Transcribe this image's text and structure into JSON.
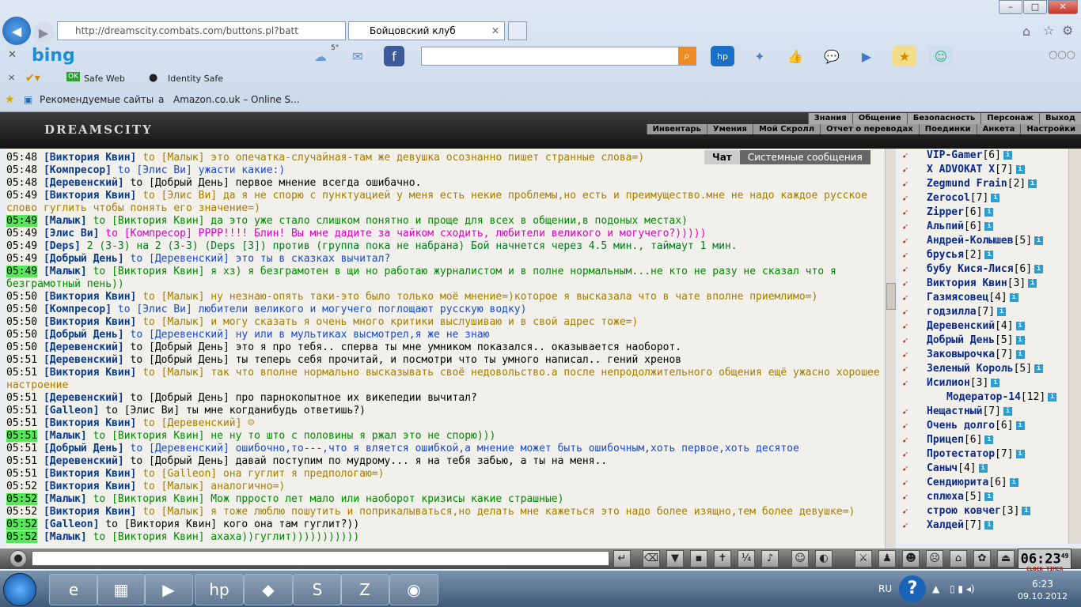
{
  "browser": {
    "address": "http://dreamscity.combats.com/buttons.pl?batt",
    "tab_title": "Бойцовский клуб",
    "bing_logo": "bing",
    "weather_temp": "5°",
    "safe_web": "Safe Web",
    "identity_safe": "Identity Safe",
    "fav_recommended": "Рекомендуемые сайты",
    "fav_amazon": "Amazon.co.uk – Online S..."
  },
  "game": {
    "logo": "DREAMSCITY",
    "menu_top": [
      "Знания",
      "Общение",
      "Безопасность",
      "Персонаж",
      "Выход"
    ],
    "menu_bottom": [
      "Инвентарь",
      "Умения",
      "Мой Скролл",
      "Отчет о переводах",
      "Поединки",
      "Анкета",
      "Настройки"
    ],
    "tab_chat": "Чат",
    "tab_system": "Системные сообщения",
    "clock_time": "06:23",
    "clock_sec": "49",
    "clock_label": "CLOCK",
    "timer_label": "TIMER"
  },
  "chat": [
    {
      "t": "05:48",
      "h": false,
      "n": "[Виктория Квин]",
      "c": "#a67c00",
      "m": "to [Малык] это опечатка-случайная-там же девушка осознанно пишет странные слова=)"
    },
    {
      "t": "05:48",
      "h": false,
      "n": "[Компресор]",
      "c": "#1a4ad0",
      "m": "to [Элис Ви] ужасти какие:)"
    },
    {
      "t": "05:48",
      "h": false,
      "n": "[Деревенский]",
      "c": "#000000",
      "m": "to [Добрый День] первое мнение всегда ошибачно."
    },
    {
      "t": "05:49",
      "h": false,
      "n": "[Виктория Квин]",
      "c": "#a67c00",
      "m": "to [Элис Ви] да я не спорю с пунктуацией у меня есть некие проблемы,но есть и преимущество.мне не надо каждое русское слово гуглить чтобы понять его значение=)"
    },
    {
      "t": "05:49",
      "h": true,
      "n": "[Малык]",
      "c": "#008a00",
      "m": "to [Виктория Квин] да это уже стало слишком понятно и проще для всех в общении,в подоных местах)"
    },
    {
      "t": "05:49",
      "h": false,
      "n": "[Элис Ви]",
      "c": "#e000c8",
      "m": "to [Компресор] РРРР!!!! Блин! Вы мне дадите за чайком сходить, любители великого и могучего?)))))"
    },
    {
      "t": "05:49",
      "h": false,
      "n": "[Deps]",
      "c": "#007a20",
      "m": "2 (3-3) на 2 (3-3) (Deps [3]) против (группа пока не набрана) Бой начнется через 4.5 мин., таймаут 1 мин."
    },
    {
      "t": "05:49",
      "h": false,
      "n": "[Добрый День]",
      "c": "#1a4ad0",
      "m": "to [Деревенский] это ты в сказках вычитал?"
    },
    {
      "t": "05:49",
      "h": true,
      "n": "[Малык]",
      "c": "#008a00",
      "m": "to [Виктория Квин] я хз) я безграмотен в щи но работаю журналистом и в полне нормальным...не кто не разу не сказал что я безграмотный пень))"
    },
    {
      "t": "05:50",
      "h": false,
      "n": "[Виктория Квин]",
      "c": "#a67c00",
      "m": "to [Малык] ну незнаю-опять таки-это было только моё мнение=)которое я высказала что в чате вполне приемлимо=)"
    },
    {
      "t": "05:50",
      "h": false,
      "n": "[Компресор]",
      "c": "#1a4ad0",
      "m": "to [Элис Ви] любители великого и могучего поглощают русскую водку)"
    },
    {
      "t": "05:50",
      "h": false,
      "n": "[Виктория Квин]",
      "c": "#a67c00",
      "m": "to [Малык] и могу сказать я очень много критики выслушиваю и в свой адрес тоже=)"
    },
    {
      "t": "05:50",
      "h": false,
      "n": "[Добрый День]",
      "c": "#1a4ad0",
      "m": "to [Деревенский] ну или в мультиках высмотрел,я же не знаю"
    },
    {
      "t": "05:50",
      "h": false,
      "n": "[Деревенский]",
      "c": "#000000",
      "m": "to [Добрый День] это я про тебя.. сперва ты мне умником показался.. оказывается наоборот."
    },
    {
      "t": "05:51",
      "h": false,
      "n": "[Деревенский]",
      "c": "#000000",
      "m": "to [Добрый День] ты теперь себя прочитай, и посмотри что ты умного написал.. гений хренов"
    },
    {
      "t": "05:51",
      "h": false,
      "n": "[Виктория Квин]",
      "c": "#a67c00",
      "m": "to [Малык] так что вполне нормально высказывать своё недовольство.а после непродолжительного общения ещё ужасно хорошее настроение"
    },
    {
      "t": "05:51",
      "h": false,
      "n": "[Деревенский]",
      "c": "#000000",
      "m": "to [Добрый День] про парнокопытное их викепедии вычитал?"
    },
    {
      "t": "05:51",
      "h": false,
      "n": "[Galleon]",
      "c": "#000000",
      "m": "to [Элис Ви] ты мне когданибудь ответишь?)"
    },
    {
      "t": "05:51",
      "h": false,
      "n": "[Виктория Квин]",
      "c": "#a67c00",
      "m": "to [Деревенский] ☺"
    },
    {
      "t": "05:51",
      "h": true,
      "n": "[Малык]",
      "c": "#008a00",
      "m": "to [Виктория Квин] не ну то што с половины я ржал это не спорю)))"
    },
    {
      "t": "05:51",
      "h": false,
      "n": "[Добрый День]",
      "c": "#1a4ad0",
      "m": "to [Деревенский] ошибочно,то---,что я вляется ошибкой,а мнение может быть ошибочным,хоть первое,хоть десятое"
    },
    {
      "t": "05:51",
      "h": false,
      "n": "[Деревенский]",
      "c": "#000000",
      "m": "to [Добрый День] давай поступим по мудрому... я на тебя забью, а ты на меня.."
    },
    {
      "t": "05:51",
      "h": false,
      "n": "[Виктория Квин]",
      "c": "#a67c00",
      "m": "to [Galleon] она гуглит я предпологаю=)"
    },
    {
      "t": "05:52",
      "h": false,
      "n": "[Виктория Квин]",
      "c": "#a67c00",
      "m": "to [Малык] аналогично=)"
    },
    {
      "t": "05:52",
      "h": true,
      "n": "[Малык]",
      "c": "#008a00",
      "m": "to [Виктория Квин] Мож прросто лет мало или наоборот кризисы какие страшные)"
    },
    {
      "t": "05:52",
      "h": false,
      "n": "[Виктория Квин]",
      "c": "#a67c00",
      "m": "to [Малык] я тоже люблю пошутить и поприкалываться,но делать мне кажеться это надо более изящно,тем более девушке=)"
    },
    {
      "t": "05:52",
      "h": true,
      "n": "[Galleon]",
      "c": "#000000",
      "m": "to [Виктория Квин] кого она там гуглит?))"
    },
    {
      "t": "05:52",
      "h": true,
      "n": "[Малык]",
      "c": "#008a00",
      "m": "to [Виктория Квин] ахаха))гуглит)))))))))))"
    }
  ],
  "users": [
    {
      "name": "VIP-Gamer",
      "lv": "[6]"
    },
    {
      "name": "X ADVOKAT X",
      "lv": "[7]"
    },
    {
      "name": "Zegmund Frain",
      "lv": "[2]"
    },
    {
      "name": "Zerocol",
      "lv": "[7]"
    },
    {
      "name": "Zipper",
      "lv": "[6]"
    },
    {
      "name": "Альпий",
      "lv": "[6]"
    },
    {
      "name": "Андрей-Колышев",
      "lv": "[5]"
    },
    {
      "name": "брусья",
      "lv": "[2]"
    },
    {
      "name": "бубу Кися-Лися",
      "lv": "[6]"
    },
    {
      "name": "Виктория Квин",
      "lv": "[3]"
    },
    {
      "name": "Газмясовец",
      "lv": "[4]"
    },
    {
      "name": "годзилла",
      "lv": "[7]"
    },
    {
      "name": "Деревенский",
      "lv": "[4]"
    },
    {
      "name": "Добрый День",
      "lv": "[5]"
    },
    {
      "name": "Заковырочка",
      "lv": "[7]"
    },
    {
      "name": "Зеленый Король",
      "lv": "[5]"
    },
    {
      "name": "Исилион",
      "lv": "[3]"
    },
    {
      "name": "Модератор-14",
      "lv": "[12]",
      "mod": true
    },
    {
      "name": "Нещастный",
      "lv": "[7]"
    },
    {
      "name": "Очень долго",
      "lv": "[6]"
    },
    {
      "name": "Прицеп",
      "lv": "[6]"
    },
    {
      "name": "Протестатор",
      "lv": "[7]"
    },
    {
      "name": "Саныч",
      "lv": "[4]"
    },
    {
      "name": "Сендиюрита",
      "lv": "[6]"
    },
    {
      "name": "сплюха",
      "lv": "[5]"
    },
    {
      "name": "строю ковчег",
      "lv": "[3]"
    },
    {
      "name": "Халдей",
      "lv": "[7]"
    }
  ],
  "taskbar": {
    "lang": "RU",
    "time": "6:23",
    "date": "09.10.2012"
  }
}
